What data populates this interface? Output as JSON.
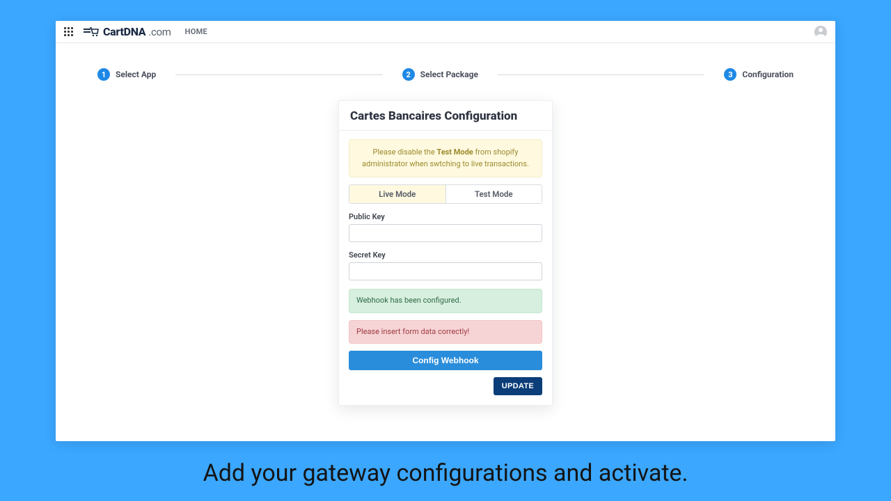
{
  "header": {
    "brand_main": "CartDNA",
    "brand_suffix": ".com",
    "home_label": "HOME"
  },
  "stepper": {
    "steps": [
      {
        "num": "1",
        "label": "Select App"
      },
      {
        "num": "2",
        "label": "Select Package"
      },
      {
        "num": "3",
        "label": "Configuration"
      }
    ]
  },
  "card": {
    "title": "Cartes Bancaires Configuration",
    "warning_pre": "Please disable the ",
    "warning_bold": "Test Mode",
    "warning_post": " from shopify administrator when swtching to live transactions.",
    "tabs": {
      "live": "Live Mode",
      "test": "Test Mode",
      "active": "live"
    },
    "fields": {
      "public_key_label": "Public Key",
      "public_key_value": "",
      "secret_key_label": "Secret Key",
      "secret_key_value": ""
    },
    "success_msg": "Webhook has been configured.",
    "error_msg": "Please insert form data correctly!",
    "webhook_btn": "Config Webhook",
    "update_btn": "UPDATE"
  },
  "caption": "Add your gateway configurations and activate."
}
